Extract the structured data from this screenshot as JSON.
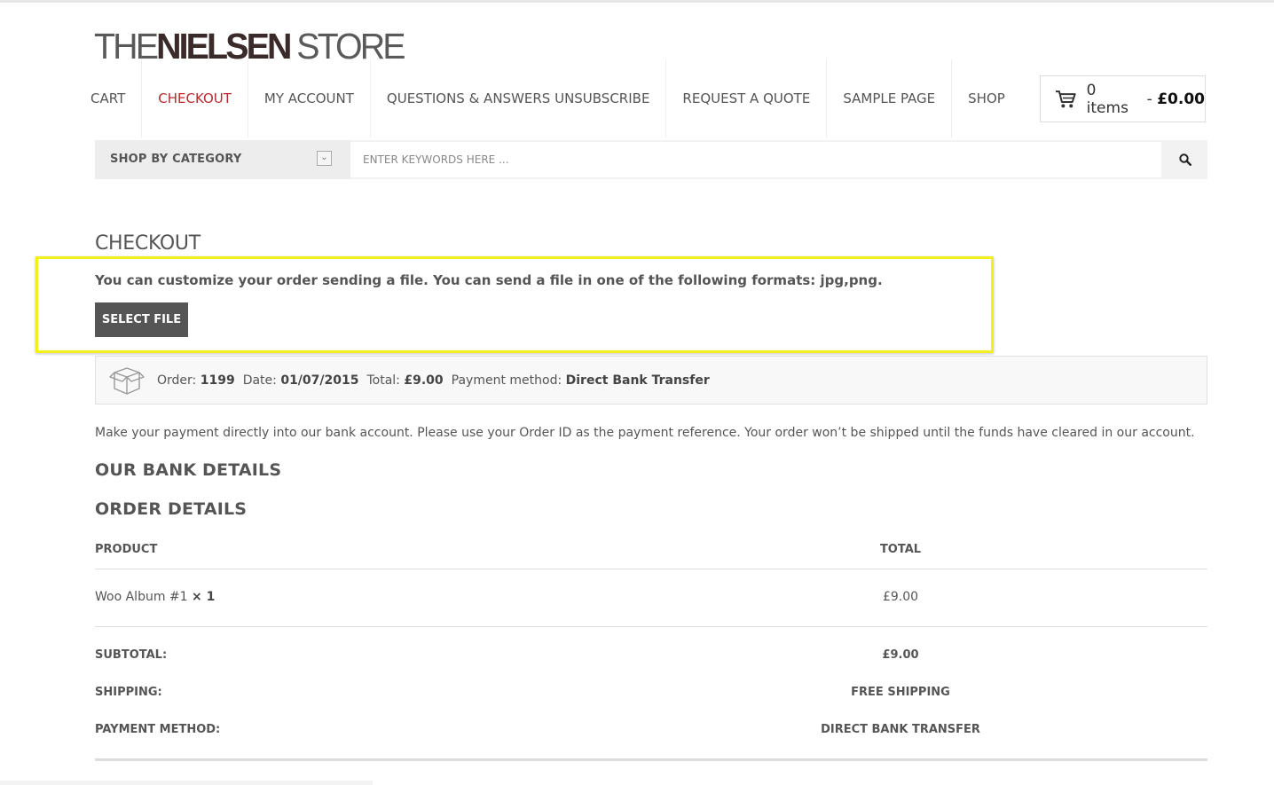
{
  "site": {
    "logo_part1": "THE",
    "logo_part2": "NIELSEN",
    "logo_part3": "STORE"
  },
  "nav": {
    "items": [
      {
        "label": "CART"
      },
      {
        "label": "CHECKOUT",
        "active": true
      },
      {
        "label": "MY ACCOUNT"
      },
      {
        "label": "QUESTIONS & ANSWERS UNSUBSCRIBE"
      },
      {
        "label": "REQUEST A QUOTE"
      },
      {
        "label": "SAMPLE PAGE"
      },
      {
        "label": "SHOP"
      }
    ],
    "active_color": "#b62a2a"
  },
  "cart": {
    "items_text": "0 items",
    "separator": " - ",
    "total": "£0.00",
    "icon": "shopping-cart-icon"
  },
  "search": {
    "category_label": "SHOP BY CATEGORY",
    "placeholder": "ENTER KEYWORDS HERE ...",
    "icon": "search-icon"
  },
  "page": {
    "title": "CHECKOUT",
    "custom_note": "You can customize your order sending a file. You can send a file in one of the following formats: jpg,png.",
    "select_file_label": "SELECT FILE",
    "highlight_color": "#f2f01a"
  },
  "order_summary": {
    "icon": "package-box-icon",
    "order_label": "Order:",
    "order_value": "1199",
    "date_label": "Date:",
    "date_value": "01/07/2015",
    "total_label": "Total:",
    "total_value": "£9.00",
    "method_label": "Payment method:",
    "method_value": "Direct Bank Transfer"
  },
  "payment_note": "Make your payment directly into our bank account. Please use your Order ID as the payment reference. Your order won’t be shipped until the funds have cleared in our account.",
  "bank_heading": "OUR BANK DETAILS",
  "order_heading": "ORDER DETAILS",
  "order_table": {
    "headers": {
      "product": "PRODUCT",
      "total": "TOTAL"
    },
    "item": {
      "name": "Woo Album #1",
      "qty": "× 1",
      "total": "£9.00"
    },
    "summary": [
      {
        "label": "SUBTOTAL:",
        "value": "£9.00"
      },
      {
        "label": "SHIPPING:",
        "value": "FREE SHIPPING"
      },
      {
        "label": "PAYMENT METHOD:",
        "value": "DIRECT BANK TRANSFER"
      }
    ]
  }
}
